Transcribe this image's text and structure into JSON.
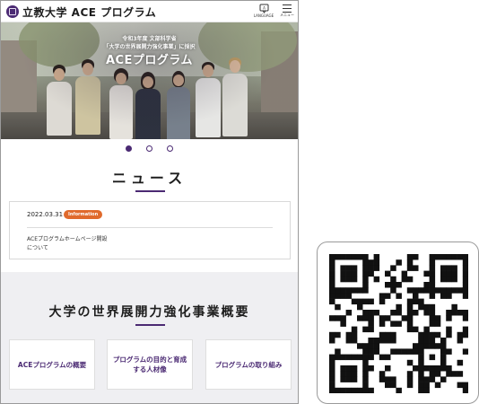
{
  "header": {
    "site_title": "立教大学 ACE プログラム",
    "language_label": "LANGUAGE",
    "menu_label": "メニュー"
  },
  "hero": {
    "line1": "令和3年度 文部科学省",
    "line2": "「大学の世界展開力強化事業」に採択",
    "title": "ACEプログラム"
  },
  "carousel": {
    "slide_count": 3,
    "active_index": 0
  },
  "news": {
    "heading": "ニュース",
    "items": [
      {
        "date": "2022.03.31",
        "tag": "Information",
        "title": "ACEプログラムホームページ開設について"
      }
    ]
  },
  "overview": {
    "heading": "大学の世界展開力強化事業概要",
    "cards": [
      {
        "label": "ACEプログラムの概要"
      },
      {
        "label": "プログラムの目的と育成する人材像"
      },
      {
        "label": "プログラムの取り組み"
      }
    ]
  },
  "colors": {
    "brand_purple": "#4b2a73",
    "tag_orange": "#e06a2c",
    "section_bg": "#efeff2"
  }
}
